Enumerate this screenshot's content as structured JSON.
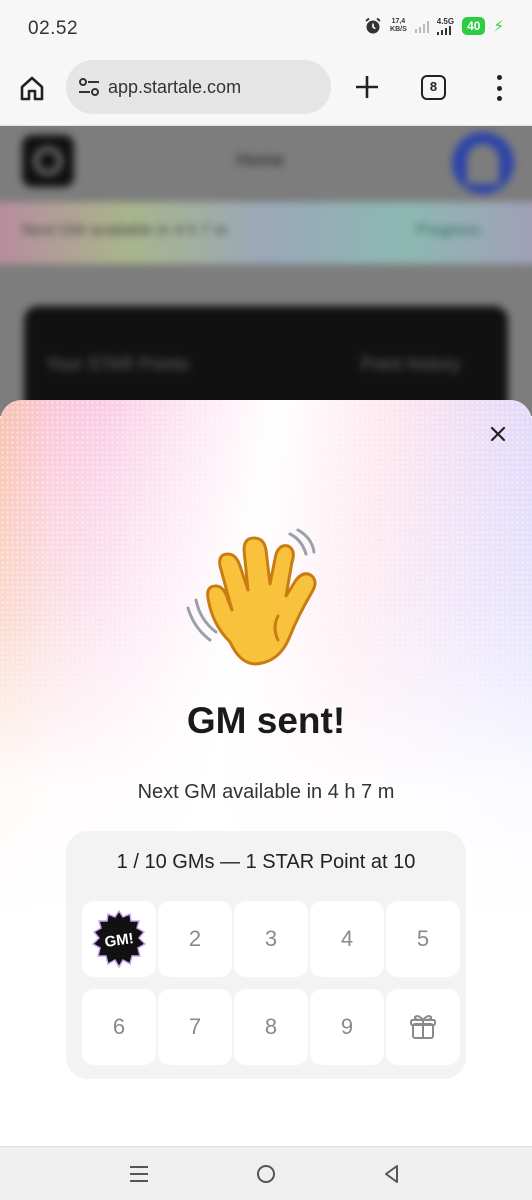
{
  "status_bar": {
    "time": "02.52",
    "net_speed": "17,4",
    "net_unit": "KB/S",
    "network": "4.5G",
    "battery": "40"
  },
  "browser": {
    "url": "app.startale.com",
    "tab_count": "8"
  },
  "background_page": {
    "title": "Home",
    "banner_text": "Next GM available in 4 h 7 m",
    "banner_action": "Progress",
    "points_label": "Your STAR Points",
    "points_history": "Point history"
  },
  "modal": {
    "emoji": "👋",
    "headline": "GM sent!",
    "next_gm": "Next GM available in 4 h 7 m",
    "progress_title": "1 / 10 GMs — 1 STAR Point at 10",
    "badge_text": "GM!",
    "progress": {
      "completed": 1,
      "total": 10
    },
    "cells": [
      {
        "label": "GM!",
        "state": "done"
      },
      {
        "label": "2",
        "state": "pending"
      },
      {
        "label": "3",
        "state": "pending"
      },
      {
        "label": "4",
        "state": "pending"
      },
      {
        "label": "5",
        "state": "pending"
      },
      {
        "label": "6",
        "state": "pending"
      },
      {
        "label": "7",
        "state": "pending"
      },
      {
        "label": "8",
        "state": "pending"
      },
      {
        "label": "9",
        "state": "pending"
      },
      {
        "label": "",
        "state": "reward",
        "icon": "gift-icon"
      }
    ]
  }
}
